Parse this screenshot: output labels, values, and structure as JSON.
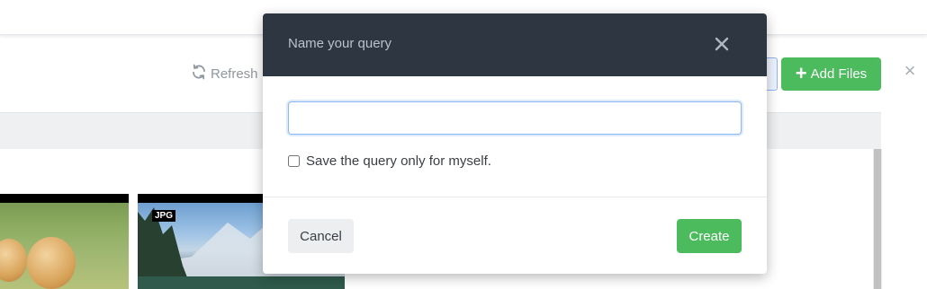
{
  "toolbar": {
    "refresh_label": "Refresh",
    "refresh_icon": "refresh-icon",
    "add_files_label": "Add Files",
    "add_files_icon": "plus-icon",
    "close_icon": "close-icon",
    "accent_color": "#4cbb5e"
  },
  "gallery": {
    "items": [
      {
        "badge": "",
        "subject": "puppies"
      },
      {
        "badge": "JPG",
        "subject": "mountain lake"
      }
    ]
  },
  "modal": {
    "title": "Name your query",
    "close_icon": "close-icon",
    "input_value": "",
    "checkbox_label": "Save the query only for myself.",
    "checkbox_checked": false,
    "cancel_label": "Cancel",
    "create_label": "Create",
    "header_color": "#2e3741"
  }
}
